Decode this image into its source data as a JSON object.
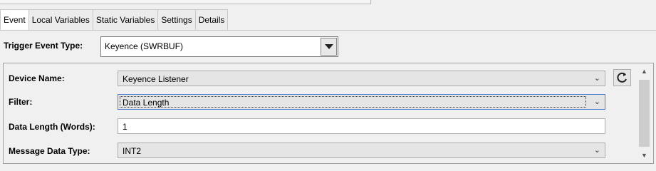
{
  "tabs": [
    {
      "label": "Event"
    },
    {
      "label": "Local Variables"
    },
    {
      "label": "Static Variables"
    },
    {
      "label": "Settings"
    },
    {
      "label": "Details"
    }
  ],
  "trigger": {
    "label": "Trigger Event Type:",
    "value": "Keyence (SWRBUF)"
  },
  "form": {
    "device_name": {
      "label": "Device Name:",
      "value": "Keyence Listener"
    },
    "filter": {
      "label": "Filter:",
      "value": "Data Length"
    },
    "data_length": {
      "label": "Data Length (Words):",
      "value": "1"
    },
    "message_data_type": {
      "label": "Message Data Type:",
      "value": "INT2"
    }
  },
  "icons": {
    "dropdown": "chevron-down-icon",
    "refresh": "refresh-icon",
    "scroll_up": "scroll-up-arrow-icon",
    "scroll_down": "scroll-down-arrow-icon"
  }
}
